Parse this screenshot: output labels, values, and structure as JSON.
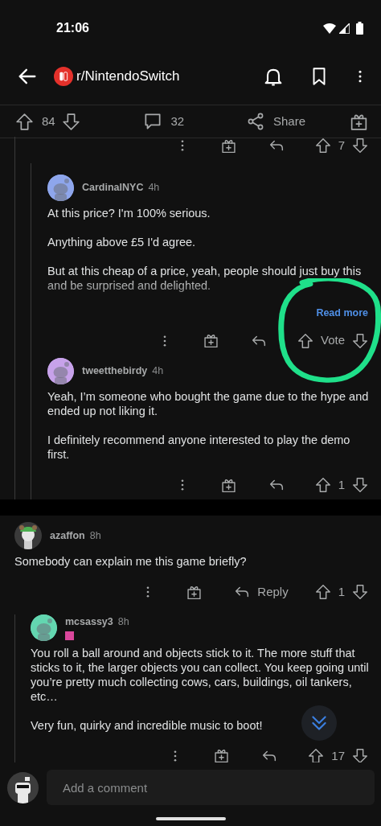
{
  "status_bar": {
    "time": "21:06"
  },
  "header": {
    "title": "r/NintendoSwitch"
  },
  "post_actions": {
    "score": "84",
    "comments": "32",
    "share": "Share"
  },
  "thread_fragment": {
    "score": "7",
    "children": [
      {
        "author": "CardinalNYC",
        "age": "4h",
        "color": "#8ea6ec",
        "body": [
          "At this price? I'm 100% serious.",
          "Anything above £5 I'd agree.",
          "But at this cheap of a price, yeah, people should just buy this and be surprised and delighted."
        ],
        "read_more": "Read more",
        "score": "Vote",
        "highlighted": true
      },
      {
        "author": "tweetthebirdy",
        "age": "4h",
        "color": "#c7a2ea",
        "body": [
          "Yeah, I’m someone who bought the game due to the hype and ended up not liking it.",
          "I definitely recommend anyone interested to play the demo first."
        ],
        "score": "1"
      }
    ]
  },
  "comments": [
    {
      "author": "azaffon",
      "age": "8h",
      "kind": "figure",
      "body": [
        "Somebody can explain me this game briefly?"
      ],
      "reply_label": "Reply",
      "score": "1",
      "children": [
        {
          "author": "mcsassy3",
          "age": "8h",
          "color": "#63d6b0",
          "flair": true,
          "body": [
            "You roll a ball around and objects stick to it. The more stuff that sticks to it, the larger objects you can collect. You keep going until you’re pretty much collecting cows, cars, buildings, oil tankers, etc…",
            "Very fun, quirky and incredible music to boot!"
          ],
          "score": "17"
        }
      ]
    }
  ],
  "comment_bar": {
    "placeholder": "Add a comment"
  }
}
